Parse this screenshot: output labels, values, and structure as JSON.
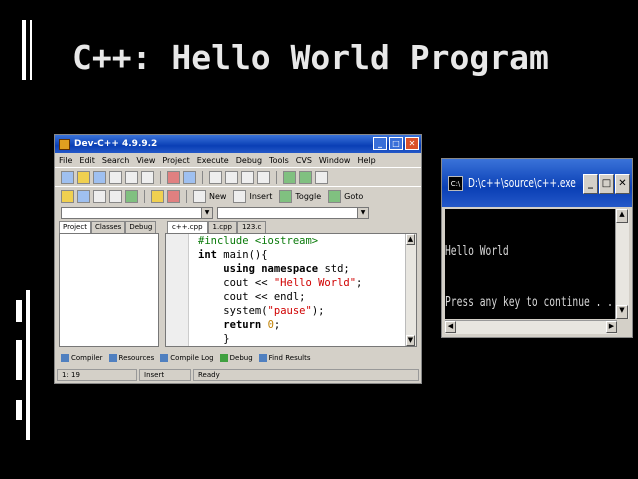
{
  "slide": {
    "title": "C++: Hello World Program"
  },
  "devcpp": {
    "window_title": "Dev-C++ 4.9.9.2",
    "menu": [
      "File",
      "Edit",
      "Search",
      "View",
      "Project",
      "Execute",
      "Debug",
      "Tools",
      "CVS",
      "Window",
      "Help"
    ],
    "toolbar": {
      "new_label": "New",
      "insert_label": "Insert",
      "toggle_label": "Toggle",
      "goto_label": "Goto"
    },
    "left_tabs": [
      "Project",
      "Classes",
      "Debug"
    ],
    "editor_tabs": [
      "c++.cpp",
      "1.cpp",
      "123.c"
    ],
    "code_lines": [
      "#include <iostream>",
      "int main(){",
      "    using namespace std;",
      "    cout << \"Hello World\";",
      "    cout << endl;",
      "    system(\"pause\");",
      "    return 0;",
      "    }"
    ],
    "bottom_tabs": [
      "Compiler",
      "Resources",
      "Compile Log",
      "Debug",
      "Find Results"
    ],
    "status": {
      "position": "1: 19",
      "mode": "Insert",
      "state": "Ready"
    }
  },
  "console": {
    "title": "D:\\c++\\source\\c++.exe",
    "lines": [
      "Hello World",
      "Press any key to continue . . ."
    ],
    "icon_label": "C:\\"
  },
  "colors": {
    "background": "#000000",
    "title_text": "#e8e8e8",
    "xp_titlebar": "#0a3fb5"
  }
}
